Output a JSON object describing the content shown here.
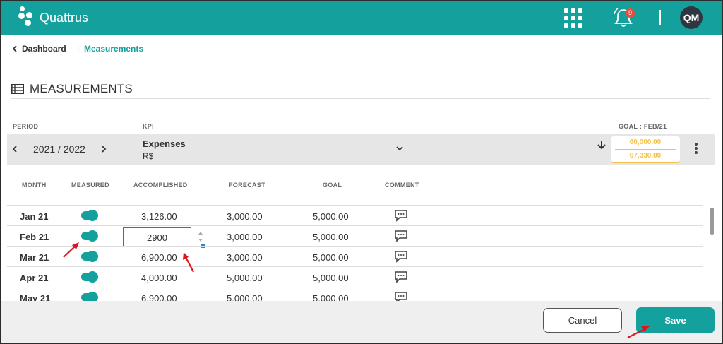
{
  "app": {
    "brand": "Quattrus",
    "notifications_count": "9",
    "user_initials": "QM"
  },
  "breadcrumb": {
    "back_label": "Dashboard",
    "current": "Measurements"
  },
  "page": {
    "title": "MEASUREMENTS"
  },
  "filters": {
    "period_label": "PERIOD",
    "period_value": "2021 / 2022",
    "kpi_label": "KPI",
    "kpi_name": "Expenses",
    "kpi_unit": "R$",
    "goal_label": "GOAL : FEB/21",
    "goal_value": "60,000.00",
    "goal_accomplished": "67,330.00"
  },
  "table": {
    "headers": {
      "month": "MONTH",
      "measured": "MEASURED",
      "accomplished": "ACCOMPLISHED",
      "forecast": "FORECAST",
      "goal": "GOAL",
      "comment": "COMMENT"
    },
    "rows": [
      {
        "month": "Jan 21",
        "measured": true,
        "accomplished": "3,126.00",
        "forecast": "3,000.00",
        "goal": "5,000.00"
      },
      {
        "month": "Feb 21",
        "measured": true,
        "accomplished": "2900",
        "forecast": "3,000.00",
        "goal": "5,000.00"
      },
      {
        "month": "Mar 21",
        "measured": true,
        "accomplished": "6,900.00",
        "forecast": "3,000.00",
        "goal": "5,000.00"
      },
      {
        "month": "Apr 21",
        "measured": true,
        "accomplished": "4,000.00",
        "forecast": "5,000.00",
        "goal": "5,000.00"
      },
      {
        "month": "May 21",
        "measured": true,
        "accomplished": "6,900.00",
        "forecast": "5,000.00",
        "goal": "5,000.00"
      }
    ]
  },
  "actions": {
    "cancel": "Cancel",
    "save": "Save"
  },
  "colors": {
    "brand_teal": "#14a09c",
    "goal_yellow": "#f4c14c",
    "annotation_red": "#e0141e",
    "badge_red": "#e74c3c"
  }
}
